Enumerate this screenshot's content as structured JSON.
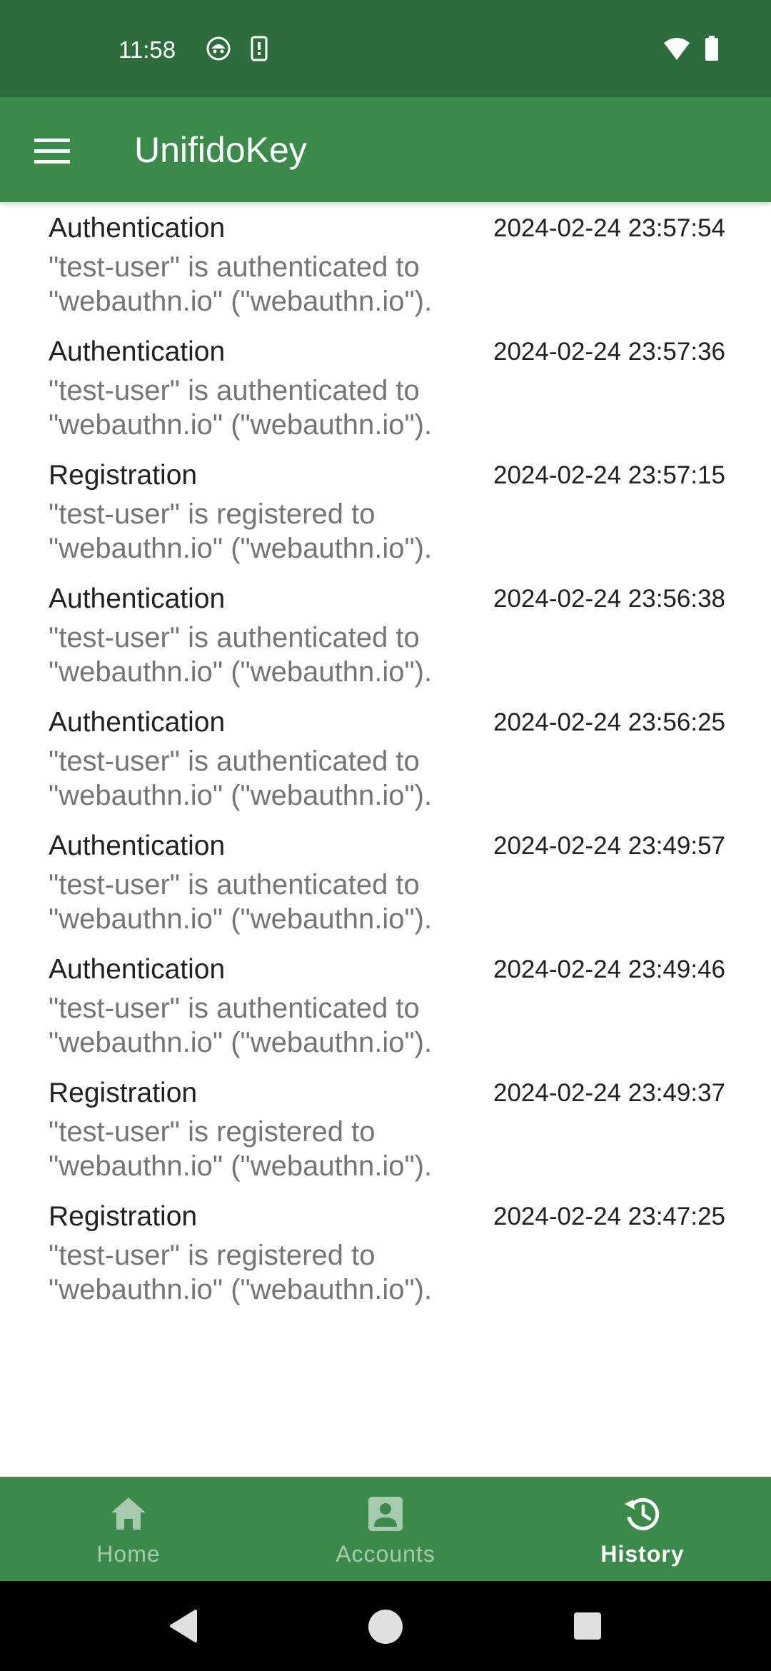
{
  "status_bar": {
    "time": "11:58",
    "icons": [
      "robot-face-icon",
      "phone-vibrate-icon",
      "wifi-icon",
      "battery-icon"
    ]
  },
  "app_bar": {
    "title": "UnifidoKey",
    "menu_icon": "hamburger-menu-icon"
  },
  "history": [
    {
      "type": "Authentication",
      "timestamp": "2024-02-24 23:57:54",
      "line1": "\"test-user\" is authenticated to",
      "line2": "\"webauthn.io\" (\"webauthn.io\")."
    },
    {
      "type": "Authentication",
      "timestamp": "2024-02-24 23:57:36",
      "line1": "\"test-user\" is authenticated to",
      "line2": "\"webauthn.io\" (\"webauthn.io\")."
    },
    {
      "type": "Registration",
      "timestamp": "2024-02-24 23:57:15",
      "line1": "\"test-user\" is registered to",
      "line2": "\"webauthn.io\" (\"webauthn.io\")."
    },
    {
      "type": "Authentication",
      "timestamp": "2024-02-24 23:56:38",
      "line1": "\"test-user\" is authenticated to",
      "line2": "\"webauthn.io\" (\"webauthn.io\")."
    },
    {
      "type": "Authentication",
      "timestamp": "2024-02-24 23:56:25",
      "line1": "\"test-user\" is authenticated to",
      "line2": "\"webauthn.io\" (\"webauthn.io\")."
    },
    {
      "type": "Authentication",
      "timestamp": "2024-02-24 23:49:57",
      "line1": "\"test-user\" is authenticated to",
      "line2": "\"webauthn.io\" (\"webauthn.io\")."
    },
    {
      "type": "Authentication",
      "timestamp": "2024-02-24 23:49:46",
      "line1": "\"test-user\" is authenticated to",
      "line2": "\"webauthn.io\" (\"webauthn.io\")."
    },
    {
      "type": "Registration",
      "timestamp": "2024-02-24 23:49:37",
      "line1": "\"test-user\" is registered to",
      "line2": "\"webauthn.io\" (\"webauthn.io\")."
    },
    {
      "type": "Registration",
      "timestamp": "2024-02-24 23:47:25",
      "line1": "\"test-user\" is registered to",
      "line2": "\"webauthn.io\" (\"webauthn.io\")."
    }
  ],
  "bottom_nav": {
    "home_label": "Home",
    "accounts_label": "Accounts",
    "history_label": "History",
    "active": "History"
  },
  "colors": {
    "status_bar": "#2e6b3d",
    "app_bar": "#3b8a4c",
    "nav_inactive": "#a7c9ae",
    "nav_active": "#ffffff",
    "text_primary": "#212121",
    "text_secondary": "#757575"
  }
}
